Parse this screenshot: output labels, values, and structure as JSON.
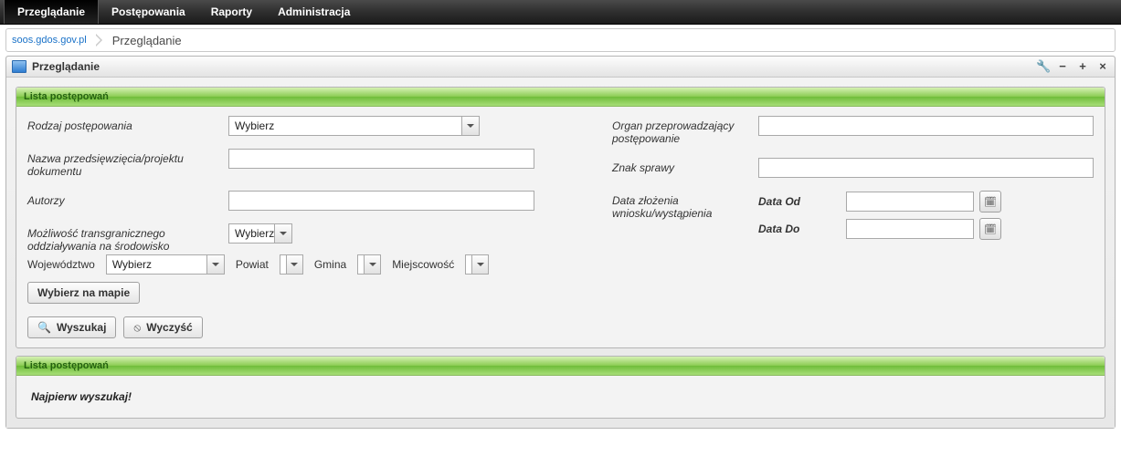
{
  "nav": {
    "items": [
      "Przeglądanie",
      "Postępowania",
      "Raporty",
      "Administracja"
    ],
    "activeIndex": 0
  },
  "breadcrumb": {
    "host": "soos.gdos.gov.pl",
    "current": "Przeglądanie"
  },
  "panel": {
    "title": "Przeglądanie"
  },
  "search_panel": {
    "title": "Lista postępowań",
    "labels": {
      "rodzaj": "Rodzaj postępowania",
      "nazwa": "Nazwa przedsięwzięcia/projektu dokumentu",
      "autorzy": "Autorzy",
      "organ": "Organ przeprowadzający postępowanie",
      "znak": "Znak sprawy",
      "data_zlozenia": "Data złożenia wniosku/wystąpienia",
      "data_od": "Data Od",
      "data_do": "Data Do",
      "transgraniczne": "Możliwość transgranicznego oddziaływania na środowisko",
      "wojewodztwo": "Województwo",
      "powiat": "Powiat",
      "gmina": "Gmina",
      "miejscowosc": "Miejscowość"
    },
    "values": {
      "rodzaj": "Wybierz",
      "nazwa": "",
      "autorzy": "",
      "organ": "",
      "znak": "",
      "data_od": "",
      "data_do": "",
      "transgraniczne": "Wybierz",
      "wojewodztwo": "Wybierz",
      "powiat": "",
      "gmina": "",
      "miejscowosc": ""
    },
    "buttons": {
      "map": "Wybierz na mapie",
      "search": "Wyszukaj",
      "clear": "Wyczyść"
    }
  },
  "results_panel": {
    "title": "Lista postępowań",
    "message": "Najpierw wyszukaj!"
  }
}
